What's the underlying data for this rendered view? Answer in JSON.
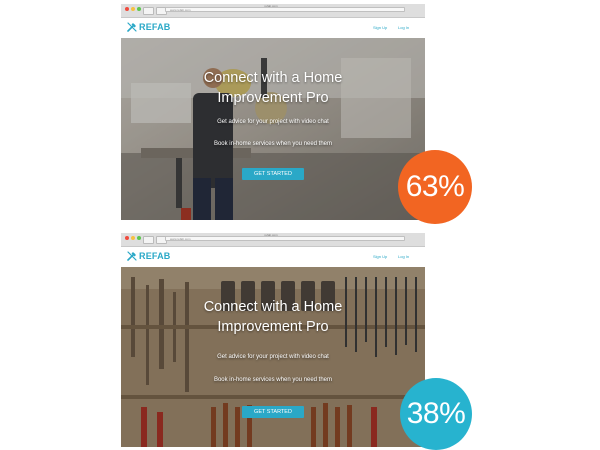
{
  "variants": [
    {
      "window_title": "refab.com",
      "url": "www.refab.com",
      "logo": "REFAB",
      "nav": {
        "signup": "Sign Up",
        "login": "Log In"
      },
      "hero": {
        "headline_line1": "Connect with a Home",
        "headline_line2": "Improvement Pro",
        "sub1": "Get advice for your project with video chat",
        "sub2": "Book in-home services when you need them",
        "cta": "GET STARTED",
        "image": "worker-with-saw"
      },
      "result": "63%",
      "result_color": "#f26522"
    },
    {
      "window_title": "refab.com",
      "url": "www.refab.com",
      "logo": "REFAB",
      "nav": {
        "signup": "Sign Up",
        "login": "Log In"
      },
      "hero": {
        "headline_line1": "Connect with a Home",
        "headline_line2": "Improvement Pro",
        "sub1": "Get advice for your project with video chat",
        "sub2": "Book in-home services when you need them",
        "cta": "GET STARTED",
        "image": "tool-wall"
      },
      "result": "38%",
      "result_color": "#27b3cf"
    }
  ],
  "colors": {
    "accent": "#2aa8c7",
    "orange": "#f26522",
    "blue": "#27b3cf"
  }
}
